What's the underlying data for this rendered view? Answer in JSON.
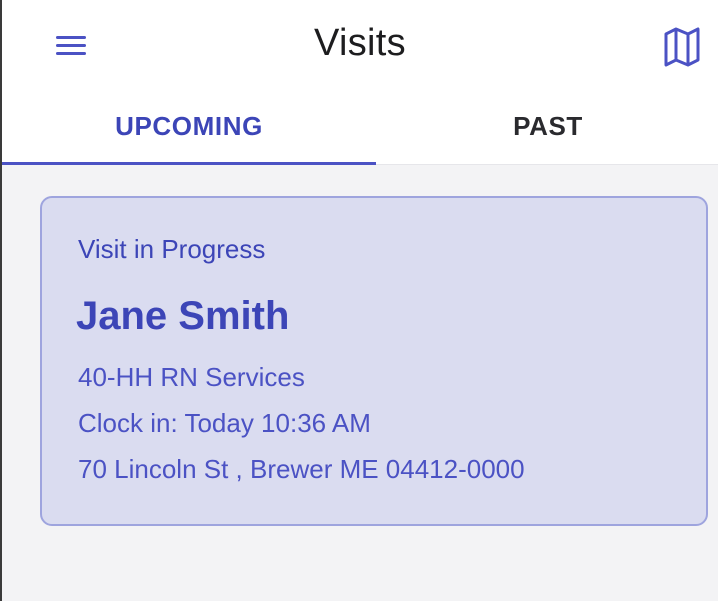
{
  "header": {
    "title": "Visits",
    "menu_icon": "hamburger-menu-icon",
    "map_icon": "map-icon",
    "accent_color": "#4b52c4"
  },
  "tabs": [
    {
      "label": "UPCOMING",
      "selected": true
    },
    {
      "label": "PAST",
      "selected": false
    }
  ],
  "visit": {
    "status": "Visit in Progress",
    "client_name": "Jane Smith",
    "service": "40-HH RN Services",
    "clock_in": "Clock in: Today 10:36 AM",
    "address": "70 Lincoln St , Brewer ME 04412-0000",
    "card_color": "#dadcf0",
    "text_color": "#3c45b7"
  }
}
